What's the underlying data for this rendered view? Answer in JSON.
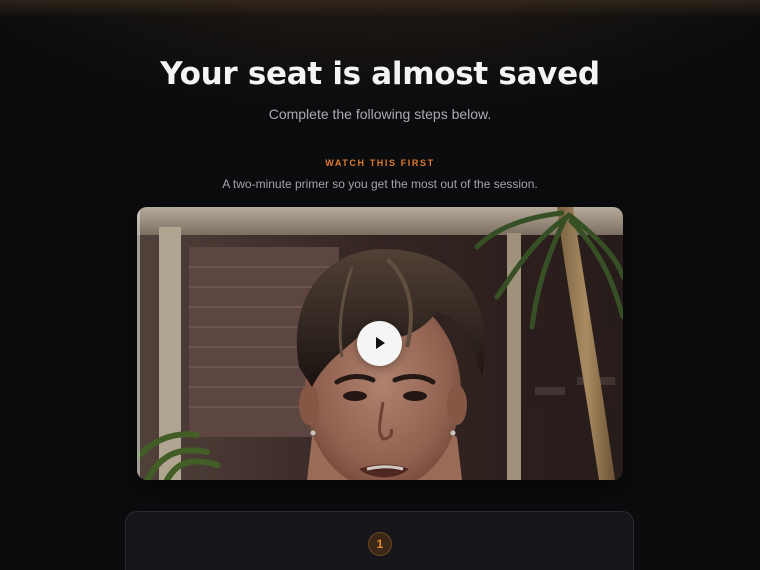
{
  "header": {
    "title": "Your seat is almost saved",
    "subtitle": "Complete the following steps below."
  },
  "video_section": {
    "eyebrow": "WATCH THIS FIRST",
    "description": "A two-minute primer so you get the most out of the session.",
    "play_icon": "play-icon"
  },
  "steps": [
    {
      "number": "1"
    }
  ],
  "colors": {
    "background": "#0b0c0e",
    "accent": "#e07a2e",
    "card": "#151619"
  }
}
